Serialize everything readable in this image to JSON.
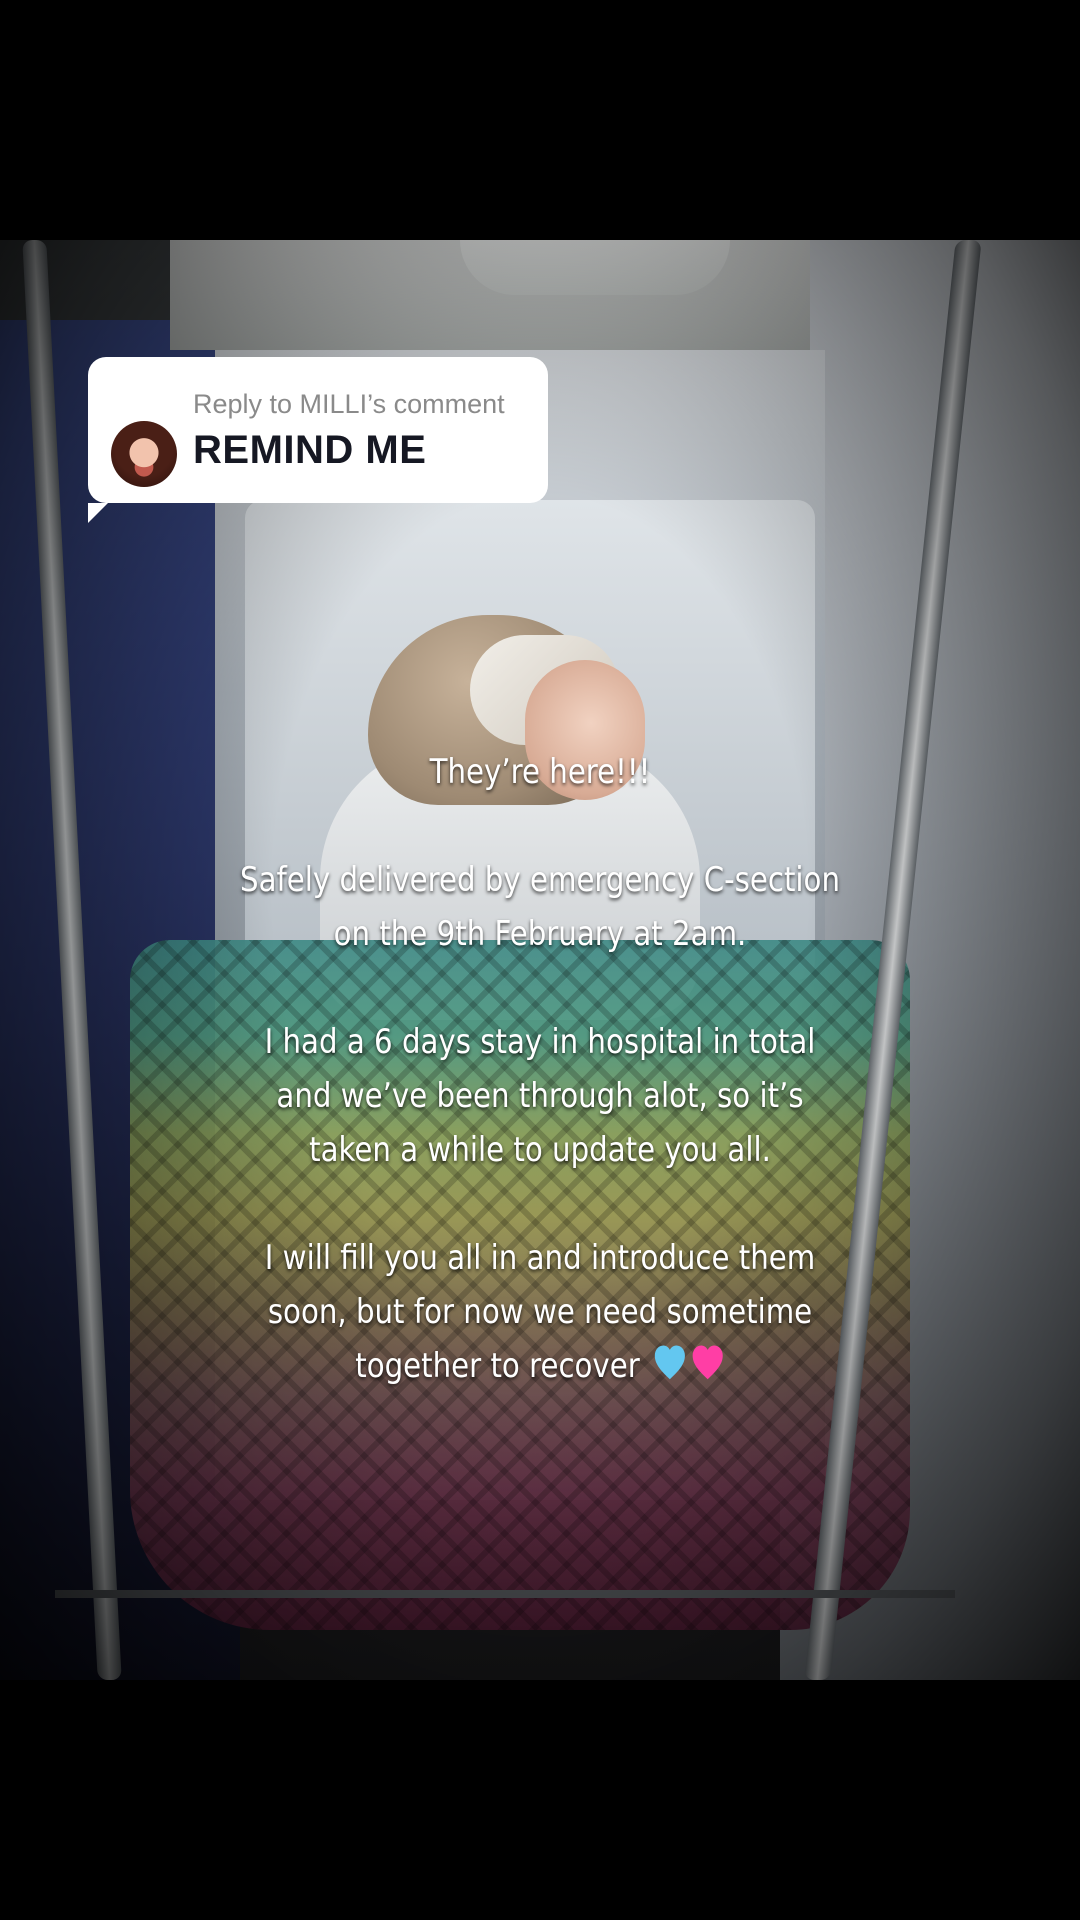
{
  "reply_bubble": {
    "reply_to": "Reply to MILLI’s comment",
    "comment": "REMIND ME"
  },
  "caption": {
    "line1": "They’re here!!!",
    "line2": "Safely delivered by emergency C-section on the 9th February at 2am.",
    "line3": "I had a 6 days stay in hospital in total and we’ve been through alot, so it’s taken a while to update you all.",
    "line4": "I will fill you all in and introduce them soon, but for now we need sometime together to recover",
    "emojis": [
      "light-blue-heart",
      "pink-heart"
    ]
  },
  "colors": {
    "bubble_bg": "#ffffff",
    "comment_text": "#161823",
    "reply_text": "#8a8a8a",
    "heart_blue": "#63c7f0",
    "heart_pink": "#ff3ea5"
  }
}
